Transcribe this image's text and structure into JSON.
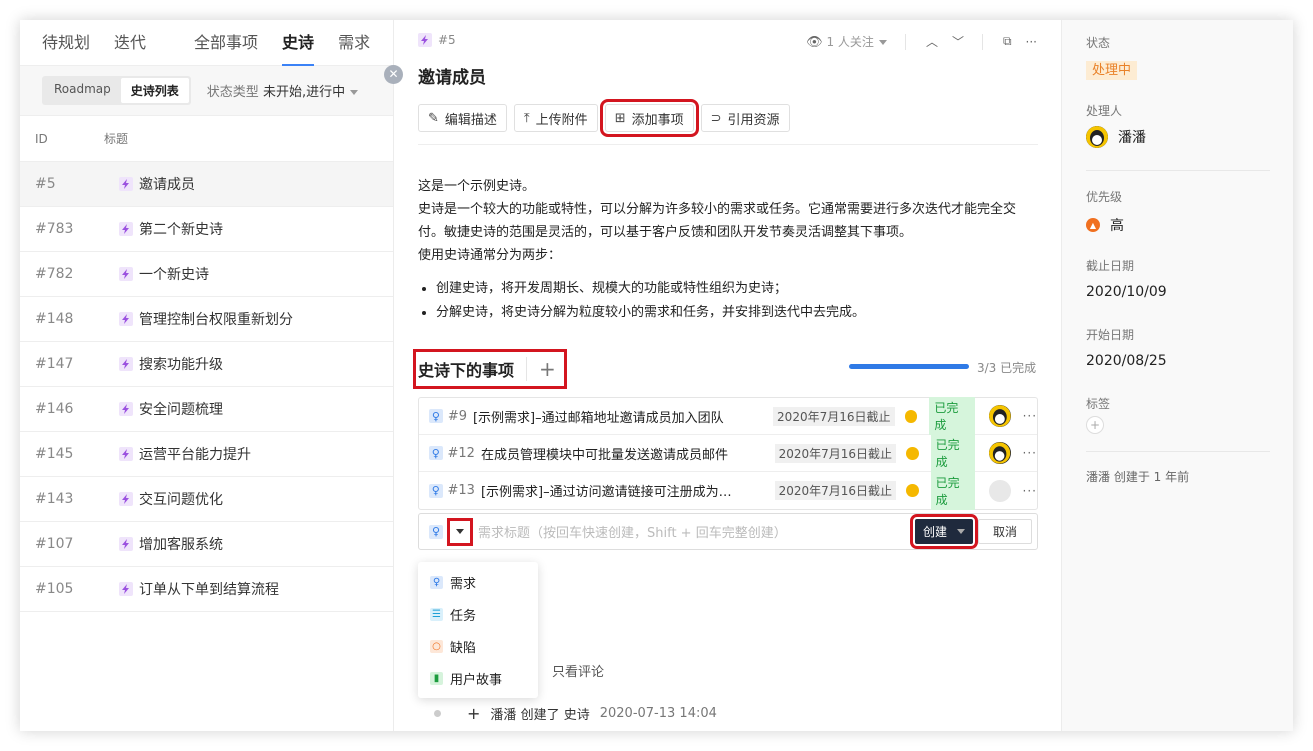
{
  "left": {
    "tabs": [
      "待规划",
      "迭代",
      "全部事项",
      "史诗",
      "需求"
    ],
    "view_options": [
      "Roadmap",
      "史诗列表"
    ],
    "filter_label": "状态类型",
    "filter_value": "未开始,进行中",
    "columns": {
      "id": "ID",
      "title": "标题"
    },
    "rows": [
      {
        "id": "#5",
        "title": "邀请成员"
      },
      {
        "id": "#783",
        "title": "第二个新史诗"
      },
      {
        "id": "#782",
        "title": "一个新史诗"
      },
      {
        "id": "#148",
        "title": "管理控制台权限重新划分"
      },
      {
        "id": "#147",
        "title": "搜索功能升级"
      },
      {
        "id": "#146",
        "title": "安全问题梳理"
      },
      {
        "id": "#145",
        "title": "运营平台能力提升"
      },
      {
        "id": "#143",
        "title": "交互问题优化"
      },
      {
        "id": "#107",
        "title": "增加客服系统"
      },
      {
        "id": "#105",
        "title": "订单从下单到结算流程"
      }
    ]
  },
  "detail": {
    "id": "#5",
    "watch": "1 人关注",
    "title": "邀请成员",
    "actions": [
      "编辑描述",
      "上传附件",
      "添加事项",
      "引用资源"
    ],
    "description": [
      "这是一个示例史诗。",
      "史诗是一个较大的功能或特性，可以分解为许多较小的需求或任务。它通常需要进行多次迭代才能完全交付。敏捷史诗的范围是灵活的，可以基于客户反馈和团队开发节奏灵活调整其下事项。",
      "使用史诗通常分为两步："
    ],
    "bullets": [
      "创建史诗，将开发周期长、规模大的功能或特性组织为史诗；",
      "分解史诗，将史诗分解为粒度较小的需求和任务，并安排到迭代中去完成。"
    ],
    "sub_title": "史诗下的事项",
    "progress_text": "3/3 已完成",
    "progress": 1.0,
    "items": [
      {
        "id": "#9",
        "title": "[示例需求]–通过邮箱地址邀请成员加入团队",
        "due": "2020年7月16日截止",
        "status": "已完成",
        "avatar": true
      },
      {
        "id": "#12",
        "title": "在成员管理模块中可批量发送邀请成员邮件",
        "due": "2020年7月16日截止",
        "status": "已完成",
        "avatar": true
      },
      {
        "id": "#13",
        "title": "[示例需求]–通过访问邀请链接可注册成为…",
        "due": "2020年7月16日截止",
        "status": "已完成",
        "avatar": false
      }
    ],
    "new_placeholder": "需求标题（按回车快速创建，Shift + 回车完整创建）",
    "create_label": "创建",
    "cancel_label": "取消",
    "type_menu": [
      "需求",
      "任务",
      "缺陷",
      "用户故事"
    ],
    "only_comments": "只看评论",
    "log": {
      "user": "潘潘",
      "action": "创建了",
      "object": "史诗",
      "time": "2020-07-13 14:04"
    }
  },
  "side": {
    "status_label": "状态",
    "status": "处理中",
    "assignee_label": "处理人",
    "assignee": "潘潘",
    "priority_label": "优先级",
    "priority": "高",
    "due_label": "截止日期",
    "due": "2020/10/09",
    "start_label": "开始日期",
    "start": "2020/08/25",
    "tags_label": "标签",
    "created": "潘潘 创建于 1 年前"
  },
  "colors": {
    "accent": "#2f7ae6",
    "epic": "#9b51e0",
    "done": "#1c9c3e",
    "status": "#e9822a",
    "highlight": "#d3151f"
  }
}
